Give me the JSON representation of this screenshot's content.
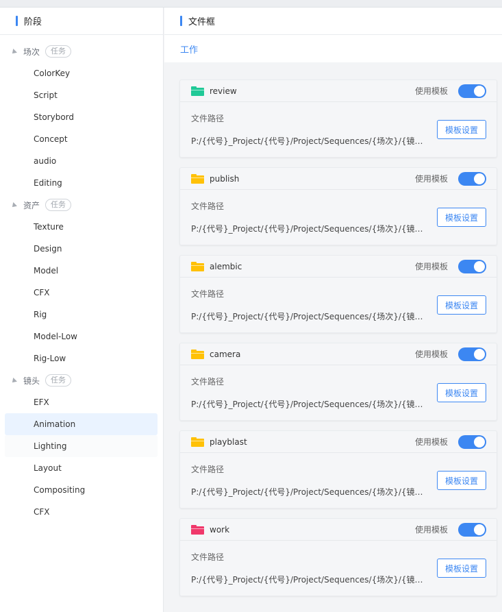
{
  "left_panel": {
    "title": "阶段",
    "groups": [
      {
        "label": "场次",
        "tag": "任务",
        "items": [
          "ColorKey",
          "Script",
          "Storybord",
          "Concept",
          "audio",
          "Editing"
        ]
      },
      {
        "label": "资产",
        "tag": "任务",
        "items": [
          "Texture",
          "Design",
          "Model",
          "CFX",
          "Rig",
          "Model-Low",
          "Rig-Low"
        ]
      },
      {
        "label": "镜头",
        "tag": "任务",
        "items": [
          "EFX",
          "Animation",
          "Lighting",
          "Layout",
          "Compositing",
          "CFX"
        ]
      }
    ],
    "selected_item": "Animation"
  },
  "right_panel": {
    "title": "文件框",
    "tab": "工作",
    "cards": [
      {
        "name": "review",
        "folder_color": "#20c997",
        "use_label": "使用模板",
        "enabled": true,
        "path_label": "文件路径",
        "path": "P:/{代号}_Project/{代号}/Project/Sequences/{场次}/{镜头号}/{阶段}/review",
        "button": "模板设置"
      },
      {
        "name": "publish",
        "folder_color": "#ffc107",
        "use_label": "使用模板",
        "enabled": true,
        "path_label": "文件路径",
        "path": "P:/{代号}_Project/{代号}/Project/Sequences/{场次}/{镜头号}/{阶段}/publish",
        "button": "模板设置"
      },
      {
        "name": "alembic",
        "folder_color": "#ffc107",
        "use_label": "使用模板",
        "enabled": true,
        "path_label": "文件路径",
        "path": "P:/{代号}_Project/{代号}/Project/Sequences/{场次}/{镜头号}/{阶段}/alembic",
        "button": "模板设置"
      },
      {
        "name": "camera",
        "folder_color": "#ffc107",
        "use_label": "使用模板",
        "enabled": true,
        "path_label": "文件路径",
        "path": "P:/{代号}_Project/{代号}/Project/Sequences/{场次}/{镜头号}/{阶段}/camera",
        "button": "模板设置"
      },
      {
        "name": "playblast",
        "folder_color": "#ffc107",
        "use_label": "使用模板",
        "enabled": true,
        "path_label": "文件路径",
        "path": "P:/{代号}_Project/{代号}/Project/Sequences/{场次}/{镜头号}/{阶段}/playblast",
        "button": "模板设置"
      },
      {
        "name": "work",
        "folder_color": "#f0386b",
        "use_label": "使用模板",
        "enabled": true,
        "path_label": "文件路径",
        "path": "P:/{代号}_Project/{代号}/Project/Sequences/{场次}/{镜头号}/{阶段}/work",
        "button": "模板设置"
      }
    ]
  },
  "colors": {
    "accent": "#3c87f2",
    "selected_bg": "#eaf3ff"
  }
}
